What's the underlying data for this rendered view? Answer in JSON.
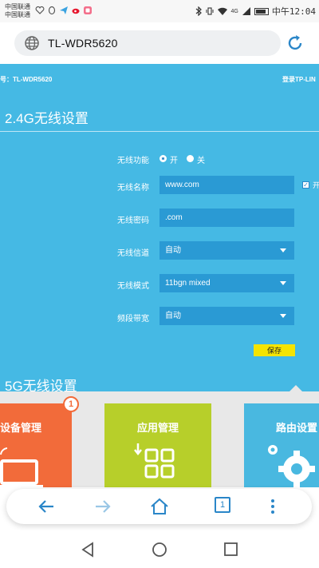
{
  "status_bar": {
    "carrier_1": "中国联通",
    "carrier_2": "中国联通",
    "signal_label": "4G",
    "time": "中午12:04",
    "icons": [
      "heart-icon",
      "qq-icon",
      "paper-plane-icon",
      "weibo-icon",
      "app-icon",
      "bluetooth-icon",
      "vibrate-icon",
      "wifi-icon",
      "signal-icon",
      "battery-icon"
    ]
  },
  "browser": {
    "url": "TL-WDR5620",
    "tab_count": "1"
  },
  "router": {
    "model_text": "号：TL-WDR5620",
    "login_text": "登录TP-LIN",
    "section_24_title": "2.4G无线设置",
    "wireless_function_label": "无线功能",
    "radio_on_label": "开",
    "radio_off_label": "关",
    "radio_selected": "开",
    "ssid_label": "无线名称",
    "ssid_value": "www.com",
    "hide_checkbox_label": "开",
    "password_label": "无线密码",
    "password_value": ".com",
    "channel_label": "无线信道",
    "channel_value": "自动",
    "mode_label": "无线模式",
    "mode_value": "11bgn mixed",
    "bandwidth_label": "频段带宽",
    "bandwidth_value": "自动",
    "save_label": "保存",
    "section_5g_title": "5G无线设置"
  },
  "tiles": [
    {
      "label": "设备管理",
      "badge": "1",
      "color": "#f26b3a"
    },
    {
      "label": "应用管理",
      "color": "#b7cf2a"
    },
    {
      "label": "路由设置",
      "color": "#49b8e0"
    }
  ],
  "colors": {
    "page_bg": "#45b9e4",
    "field_bg": "#2a9ad4",
    "save_button": "#f5e400",
    "browser_accent": "#2a86c8"
  }
}
